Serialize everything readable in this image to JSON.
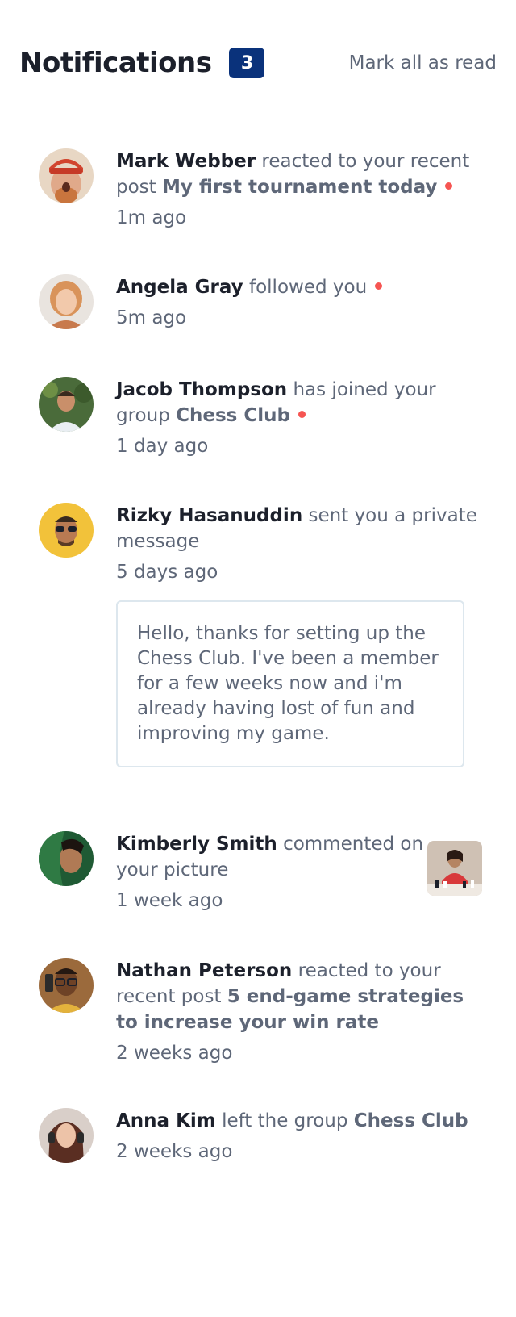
{
  "header": {
    "title": "Notifications",
    "unread_count": "3",
    "mark_all_label": "Mark all as read"
  },
  "colors": {
    "badge": "#0a327b",
    "unread_dot": "#f65552",
    "heading": "#1c202b",
    "text": "#5e6778"
  },
  "notifications": [
    {
      "actor": "Mark Webber",
      "action": "reacted to your recent post",
      "target": "My first tournament today",
      "time": "1m ago",
      "unread": true
    },
    {
      "actor": "Angela Gray",
      "action": "followed you",
      "time": "5m ago",
      "unread": true
    },
    {
      "actor": "Jacob Thompson",
      "action": "has joined your group",
      "target": "Chess Club",
      "time": "1 day ago",
      "unread": true
    },
    {
      "actor": "Rizky Hasanuddin",
      "action": "sent you a private message",
      "time": "5 days ago",
      "message": "Hello, thanks for setting up the Chess Club. I've been a member for a few weeks now and i'm already having lost of fun and improving my game.",
      "unread": false
    },
    {
      "actor": "Kimberly Smith",
      "action": "commented on your picture",
      "time": "1 week ago",
      "unread": false,
      "has_picture": true
    },
    {
      "actor": "Nathan Peterson",
      "action": "reacted to your recent post",
      "target": "5 end-game strategies to increase your win rate",
      "time": "2 weeks ago",
      "unread": false
    },
    {
      "actor": "Anna Kim",
      "action": "left the group",
      "target": "Chess Club",
      "time": "2 weeks ago",
      "unread": false
    }
  ]
}
